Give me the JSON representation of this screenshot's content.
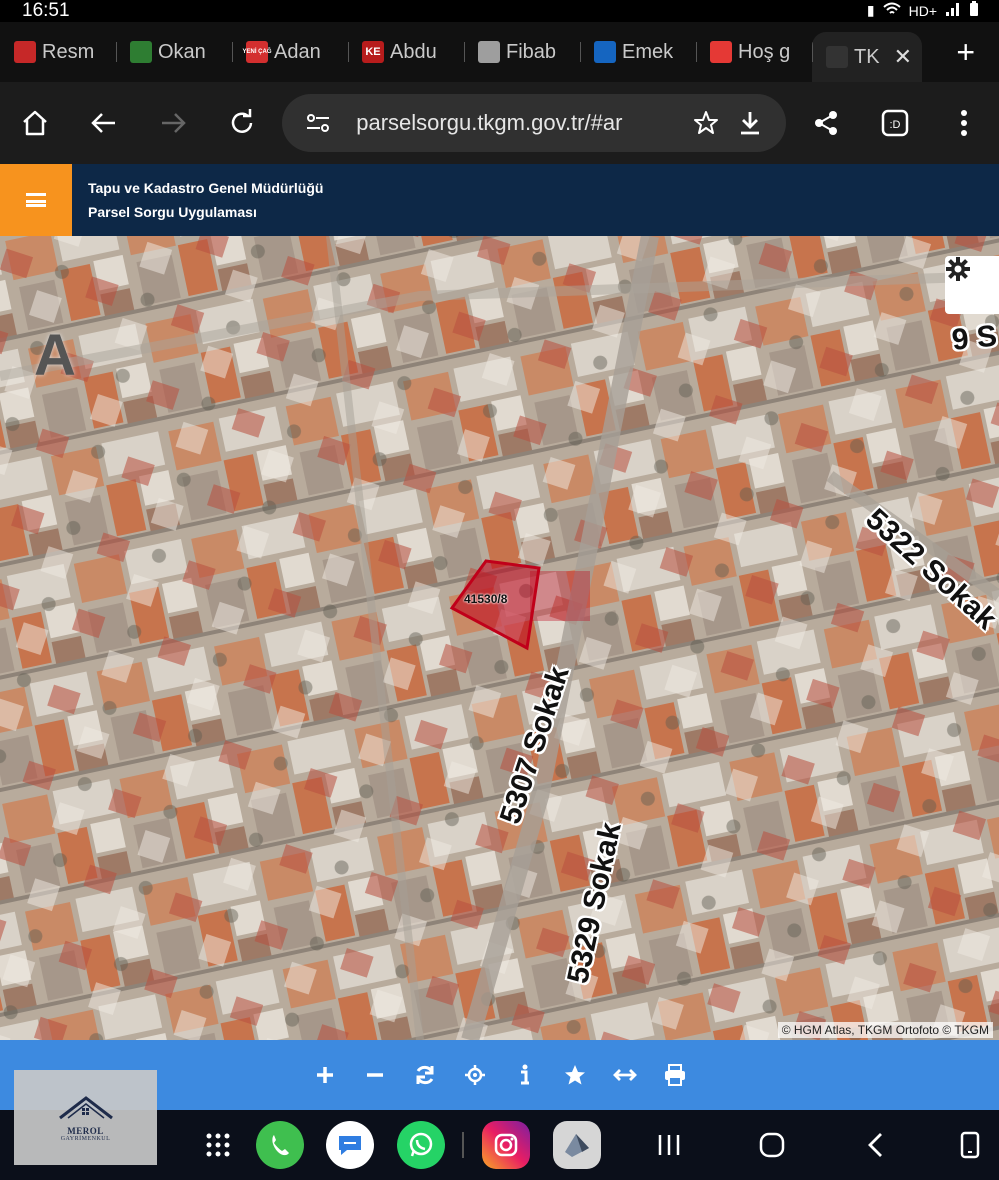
{
  "status_bar": {
    "time": "16:51",
    "network": "HD+"
  },
  "tabs": [
    {
      "label": "Resm",
      "favicon_color": "#c62828",
      "favicon_text": ""
    },
    {
      "label": "Okan",
      "favicon_color": "#2e7d32",
      "favicon_text": ""
    },
    {
      "label": "Adan",
      "favicon_color": "#d32f2f",
      "favicon_text": "YENİ ÇAĞ"
    },
    {
      "label": "Abdu",
      "favicon_color": "#b71c1c",
      "favicon_text": "KE"
    },
    {
      "label": "Fibab",
      "favicon_color": "#9e9e9e",
      "favicon_text": ""
    },
    {
      "label": "Emek",
      "favicon_color": "#1565c0",
      "favicon_text": ""
    },
    {
      "label": "Hoş g",
      "favicon_color": "#e53935",
      "favicon_text": ""
    },
    {
      "label": "TK",
      "favicon_color": "#333333",
      "favicon_text": "",
      "active": true
    }
  ],
  "toolbar": {
    "url": "parselsorgu.tkgm.gov.tr/#ar"
  },
  "site": {
    "title_line1": "Tapu ve Kadastro Genel Müdürlüğü",
    "title_line2": "Parsel Sorgu Uygulaması",
    "accent_color": "#f7931e",
    "header_color": "#0d2847"
  },
  "map": {
    "parcel_label": "41530/8",
    "parcel_color": "#c0001a",
    "streets": {
      "s5307": "5307 Sokak",
      "s5329": "5329 Sokak",
      "s5322": "5322 Sokak",
      "s9": "9 S",
      "letter": "A"
    },
    "attribution": "© HGM Atlas, TKGM Ortofoto © TKGM"
  },
  "map_toolbar": {
    "color": "#3d8ae0",
    "buttons": [
      "zoom-in",
      "zoom-out",
      "refresh",
      "locate",
      "info",
      "favorite",
      "measure",
      "print"
    ]
  },
  "logo": {
    "name": "MEROL",
    "subtitle": "GAYRİMENKUL"
  }
}
